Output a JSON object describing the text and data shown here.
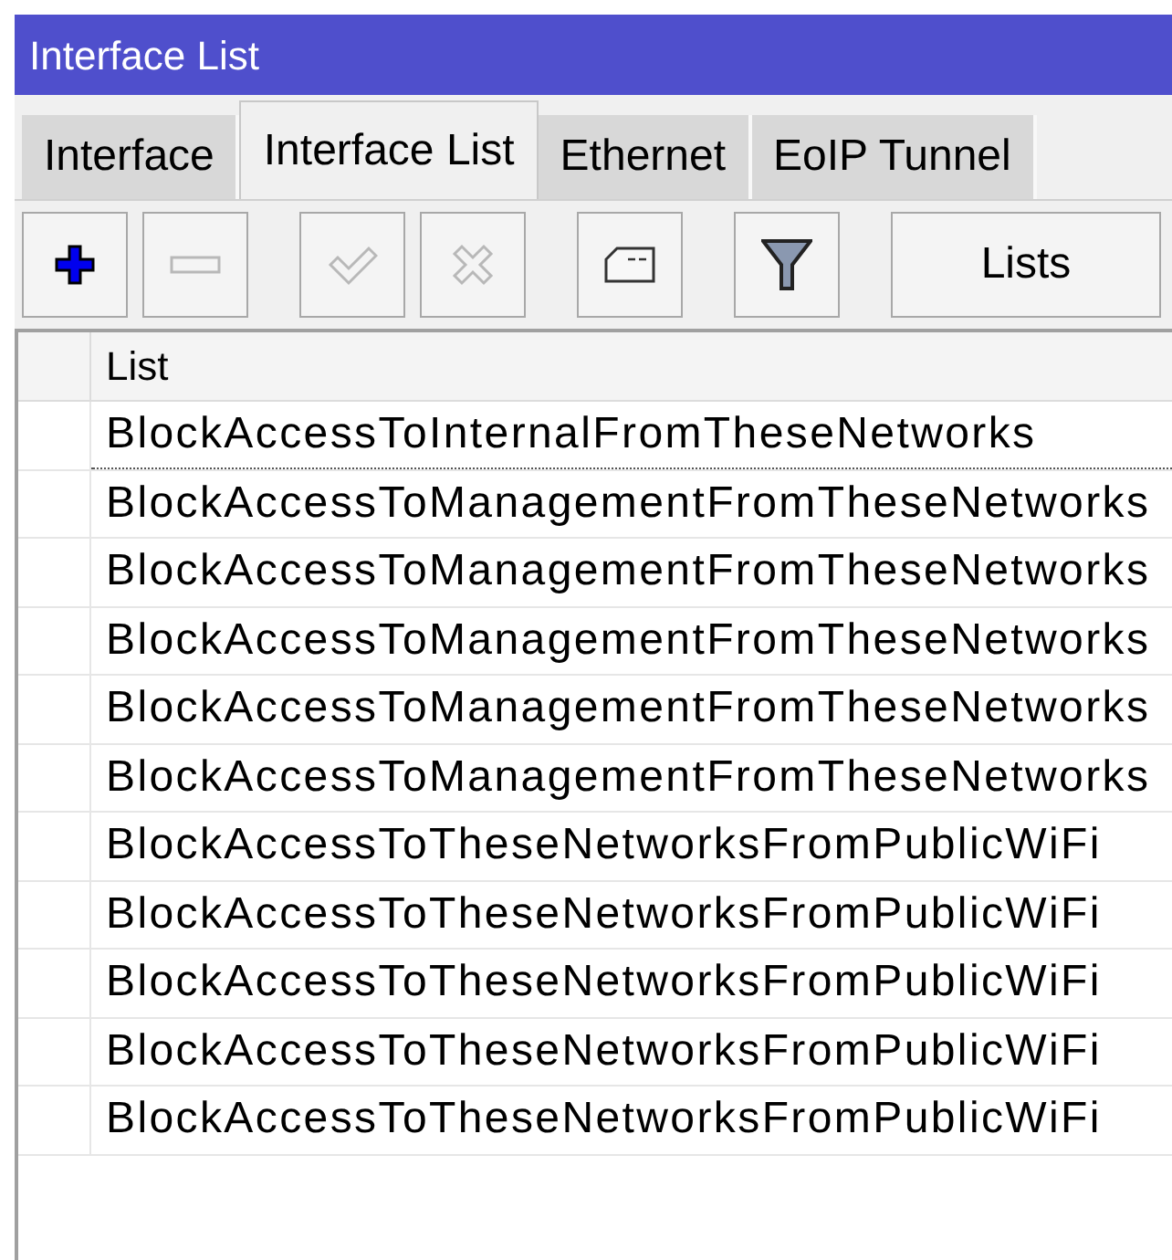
{
  "window": {
    "title": "Interface List"
  },
  "tabs": [
    {
      "label": "Interface",
      "selected": false
    },
    {
      "label": "Interface List",
      "selected": true
    },
    {
      "label": "Ethernet",
      "selected": false
    },
    {
      "label": "EoIP Tunnel",
      "selected": false
    }
  ],
  "toolbar": [
    {
      "kind": "add",
      "disabled": false
    },
    {
      "kind": "remove",
      "disabled": true
    },
    {
      "kind": "enable",
      "disabled": true
    },
    {
      "kind": "disable",
      "disabled": true
    },
    {
      "kind": "comment",
      "disabled": false
    },
    {
      "kind": "filter",
      "disabled": false
    },
    {
      "kind": "text",
      "label": "Lists",
      "disabled": false
    }
  ],
  "table": {
    "columns": [
      "List"
    ],
    "rows": [
      {
        "list": "BlockAccessToInternalFromTheseNetworks",
        "focused": true
      },
      {
        "list": "BlockAccessToManagementFromTheseNetworks",
        "focused": false
      },
      {
        "list": "BlockAccessToManagementFromTheseNetworks",
        "focused": false
      },
      {
        "list": "BlockAccessToManagementFromTheseNetworks",
        "focused": false
      },
      {
        "list": "BlockAccessToManagementFromTheseNetworks",
        "focused": false
      },
      {
        "list": "BlockAccessToManagementFromTheseNetworks",
        "focused": false
      },
      {
        "list": "BlockAccessToTheseNetworksFromPublicWiFi",
        "focused": false
      },
      {
        "list": "BlockAccessToTheseNetworksFromPublicWiFi",
        "focused": false
      },
      {
        "list": "BlockAccessToTheseNetworksFromPublicWiFi",
        "focused": false
      },
      {
        "list": "BlockAccessToTheseNetworksFromPublicWiFi",
        "focused": false
      },
      {
        "list": "BlockAccessToTheseNetworksFromPublicWiFi",
        "focused": false
      }
    ]
  }
}
